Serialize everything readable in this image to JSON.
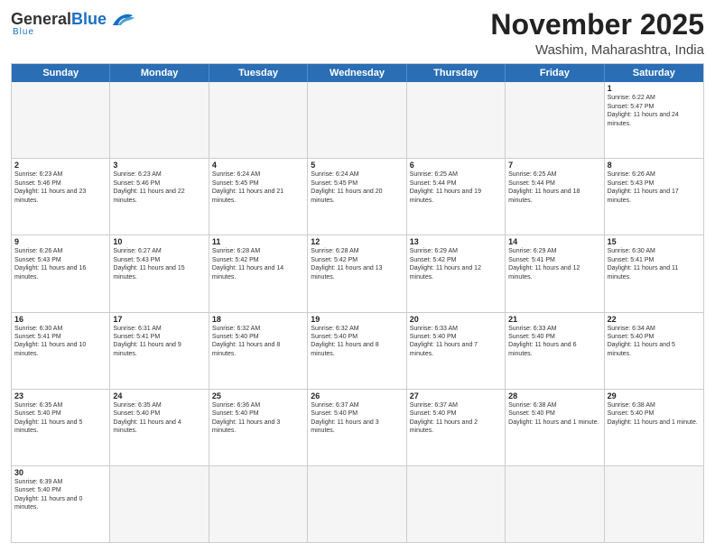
{
  "header": {
    "logo": {
      "general": "General",
      "blue": "Blue",
      "tagline": "Blue"
    },
    "title": "November 2025",
    "subtitle": "Washim, Maharashtra, India"
  },
  "calendar": {
    "days": [
      "Sunday",
      "Monday",
      "Tuesday",
      "Wednesday",
      "Thursday",
      "Friday",
      "Saturday"
    ],
    "weeks": [
      [
        {
          "day": "",
          "empty": true
        },
        {
          "day": "",
          "empty": true
        },
        {
          "day": "",
          "empty": true
        },
        {
          "day": "",
          "empty": true
        },
        {
          "day": "",
          "empty": true
        },
        {
          "day": "",
          "empty": true
        },
        {
          "day": "1",
          "sunrise": "Sunrise: 6:22 AM",
          "sunset": "Sunset: 5:47 PM",
          "daylight": "Daylight: 11 hours and 24 minutes."
        }
      ],
      [
        {
          "day": "2",
          "sunrise": "Sunrise: 6:23 AM",
          "sunset": "Sunset: 5:46 PM",
          "daylight": "Daylight: 11 hours and 23 minutes."
        },
        {
          "day": "3",
          "sunrise": "Sunrise: 6:23 AM",
          "sunset": "Sunset: 5:46 PM",
          "daylight": "Daylight: 11 hours and 22 minutes."
        },
        {
          "day": "4",
          "sunrise": "Sunrise: 6:24 AM",
          "sunset": "Sunset: 5:45 PM",
          "daylight": "Daylight: 11 hours and 21 minutes."
        },
        {
          "day": "5",
          "sunrise": "Sunrise: 6:24 AM",
          "sunset": "Sunset: 5:45 PM",
          "daylight": "Daylight: 11 hours and 20 minutes."
        },
        {
          "day": "6",
          "sunrise": "Sunrise: 6:25 AM",
          "sunset": "Sunset: 5:44 PM",
          "daylight": "Daylight: 11 hours and 19 minutes."
        },
        {
          "day": "7",
          "sunrise": "Sunrise: 6:25 AM",
          "sunset": "Sunset: 5:44 PM",
          "daylight": "Daylight: 11 hours and 18 minutes."
        },
        {
          "day": "8",
          "sunrise": "Sunrise: 6:26 AM",
          "sunset": "Sunset: 5:43 PM",
          "daylight": "Daylight: 11 hours and 17 minutes."
        }
      ],
      [
        {
          "day": "9",
          "sunrise": "Sunrise: 6:26 AM",
          "sunset": "Sunset: 5:43 PM",
          "daylight": "Daylight: 11 hours and 16 minutes."
        },
        {
          "day": "10",
          "sunrise": "Sunrise: 6:27 AM",
          "sunset": "Sunset: 5:43 PM",
          "daylight": "Daylight: 11 hours and 15 minutes."
        },
        {
          "day": "11",
          "sunrise": "Sunrise: 6:28 AM",
          "sunset": "Sunset: 5:42 PM",
          "daylight": "Daylight: 11 hours and 14 minutes."
        },
        {
          "day": "12",
          "sunrise": "Sunrise: 6:28 AM",
          "sunset": "Sunset: 5:42 PM",
          "daylight": "Daylight: 11 hours and 13 minutes."
        },
        {
          "day": "13",
          "sunrise": "Sunrise: 6:29 AM",
          "sunset": "Sunset: 5:42 PM",
          "daylight": "Daylight: 11 hours and 12 minutes."
        },
        {
          "day": "14",
          "sunrise": "Sunrise: 6:29 AM",
          "sunset": "Sunset: 5:41 PM",
          "daylight": "Daylight: 11 hours and 12 minutes."
        },
        {
          "day": "15",
          "sunrise": "Sunrise: 6:30 AM",
          "sunset": "Sunset: 5:41 PM",
          "daylight": "Daylight: 11 hours and 11 minutes."
        }
      ],
      [
        {
          "day": "16",
          "sunrise": "Sunrise: 6:30 AM",
          "sunset": "Sunset: 5:41 PM",
          "daylight": "Daylight: 11 hours and 10 minutes."
        },
        {
          "day": "17",
          "sunrise": "Sunrise: 6:31 AM",
          "sunset": "Sunset: 5:41 PM",
          "daylight": "Daylight: 11 hours and 9 minutes."
        },
        {
          "day": "18",
          "sunrise": "Sunrise: 6:32 AM",
          "sunset": "Sunset: 5:40 PM",
          "daylight": "Daylight: 11 hours and 8 minutes."
        },
        {
          "day": "19",
          "sunrise": "Sunrise: 6:32 AM",
          "sunset": "Sunset: 5:40 PM",
          "daylight": "Daylight: 11 hours and 8 minutes."
        },
        {
          "day": "20",
          "sunrise": "Sunrise: 6:33 AM",
          "sunset": "Sunset: 5:40 PM",
          "daylight": "Daylight: 11 hours and 7 minutes."
        },
        {
          "day": "21",
          "sunrise": "Sunrise: 6:33 AM",
          "sunset": "Sunset: 5:40 PM",
          "daylight": "Daylight: 11 hours and 6 minutes."
        },
        {
          "day": "22",
          "sunrise": "Sunrise: 6:34 AM",
          "sunset": "Sunset: 5:40 PM",
          "daylight": "Daylight: 11 hours and 5 minutes."
        }
      ],
      [
        {
          "day": "23",
          "sunrise": "Sunrise: 6:35 AM",
          "sunset": "Sunset: 5:40 PM",
          "daylight": "Daylight: 11 hours and 5 minutes."
        },
        {
          "day": "24",
          "sunrise": "Sunrise: 6:35 AM",
          "sunset": "Sunset: 5:40 PM",
          "daylight": "Daylight: 11 hours and 4 minutes."
        },
        {
          "day": "25",
          "sunrise": "Sunrise: 6:36 AM",
          "sunset": "Sunset: 5:40 PM",
          "daylight": "Daylight: 11 hours and 3 minutes."
        },
        {
          "day": "26",
          "sunrise": "Sunrise: 6:37 AM",
          "sunset": "Sunset: 5:40 PM",
          "daylight": "Daylight: 11 hours and 3 minutes."
        },
        {
          "day": "27",
          "sunrise": "Sunrise: 6:37 AM",
          "sunset": "Sunset: 5:40 PM",
          "daylight": "Daylight: 11 hours and 2 minutes."
        },
        {
          "day": "28",
          "sunrise": "Sunrise: 6:38 AM",
          "sunset": "Sunset: 5:40 PM",
          "daylight": "Daylight: 11 hours and 1 minute."
        },
        {
          "day": "29",
          "sunrise": "Sunrise: 6:38 AM",
          "sunset": "Sunset: 5:40 PM",
          "daylight": "Daylight: 11 hours and 1 minute."
        }
      ],
      [
        {
          "day": "30",
          "sunrise": "Sunrise: 6:39 AM",
          "sunset": "Sunset: 5:40 PM",
          "daylight": "Daylight: 11 hours and 0 minutes."
        },
        {
          "day": "",
          "empty": true
        },
        {
          "day": "",
          "empty": true
        },
        {
          "day": "",
          "empty": true
        },
        {
          "day": "",
          "empty": true
        },
        {
          "day": "",
          "empty": true
        },
        {
          "day": "",
          "empty": true
        }
      ]
    ]
  }
}
